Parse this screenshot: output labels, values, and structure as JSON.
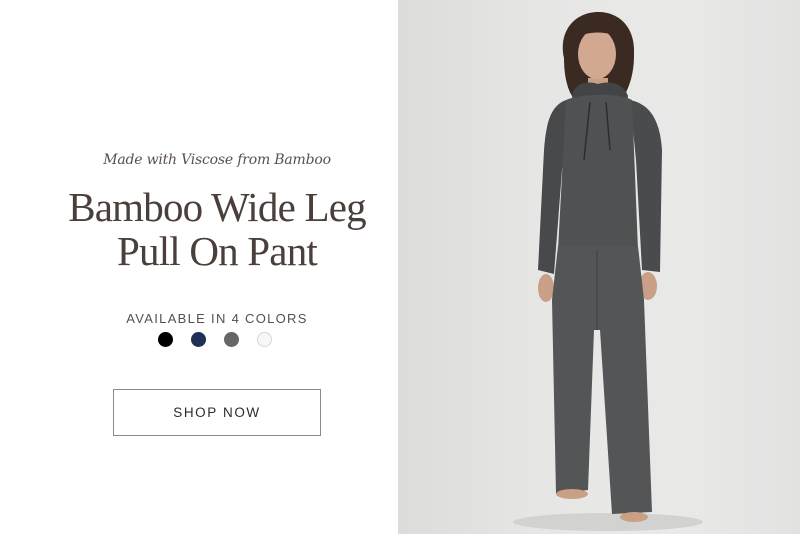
{
  "hero": {
    "eyebrow": "Made with Viscose from Bamboo",
    "title_line1": "Bamboo Wide Leg",
    "title_line2": "Pull On Pant",
    "colors_label": "AVAILABLE IN 4 COLORS",
    "swatches": [
      {
        "name": "black",
        "color": "#000000"
      },
      {
        "name": "navy",
        "color": "#1f2f55"
      },
      {
        "name": "charcoal",
        "color": "#666666"
      },
      {
        "name": "white",
        "color": "#f7f7f7"
      }
    ],
    "cta_label": "SHOP NOW"
  },
  "product_image": {
    "subject": "model-wearing-charcoal-hoodie-and-wide-leg-pant",
    "garment_color": "#4d4e50",
    "background_color": "#e6e6e5"
  }
}
